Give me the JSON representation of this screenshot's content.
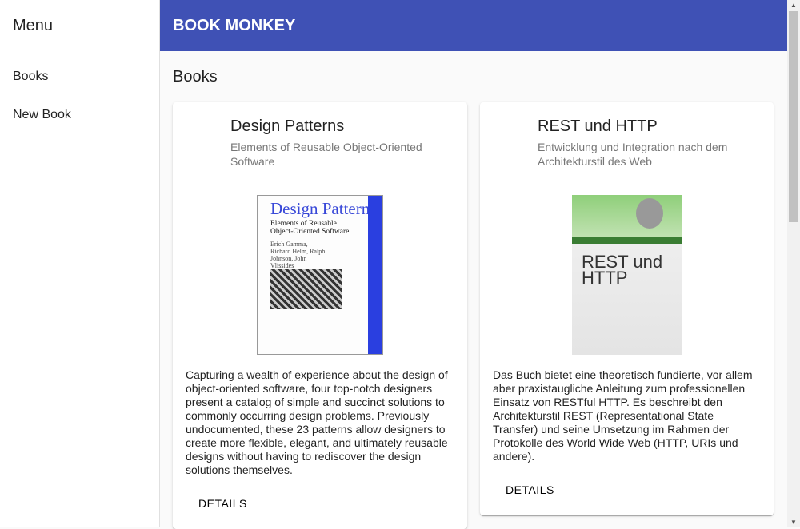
{
  "sidebar": {
    "title": "Menu",
    "items": [
      {
        "label": "Books"
      },
      {
        "label": "New Book"
      }
    ]
  },
  "toolbar": {
    "title": "BOOK MONKEY"
  },
  "page": {
    "heading": "Books"
  },
  "books": [
    {
      "title": "Design Patterns",
      "subtitle": "Elements of Reusable Object-Oriented Software",
      "cover": {
        "title": "Design Patterns",
        "subtitle": "Elements of Reusable Object-Oriented Software",
        "authors": "Erich Gamma, Richard Helm, Ralph Johnson, John Vlissides"
      },
      "description": "Capturing a wealth of experience about the design of object-oriented software, four top-notch designers present a catalog of simple and succinct solutions to commonly occurring design problems. Previously undocumented, these 23 patterns allow designers to create more flexible, elegant, and ultimately reusable designs without having to rediscover the design solutions themselves.",
      "button": "DETAILS"
    },
    {
      "title": "REST und HTTP",
      "subtitle": "Entwicklung und Integration nach dem Architekturstil des Web",
      "cover": {
        "title": "REST und HTTP"
      },
      "description": "Das Buch bietet eine theoretisch fundierte, vor allem aber praxistaugliche Anleitung zum professionellen Einsatz von RESTful HTTP. Es beschreibt den Architekturstil REST (Representational State Transfer) und seine Umsetzung im Rahmen der Protokolle des World Wide Web (HTTP, URIs und andere).",
      "button": "DETAILS"
    }
  ]
}
